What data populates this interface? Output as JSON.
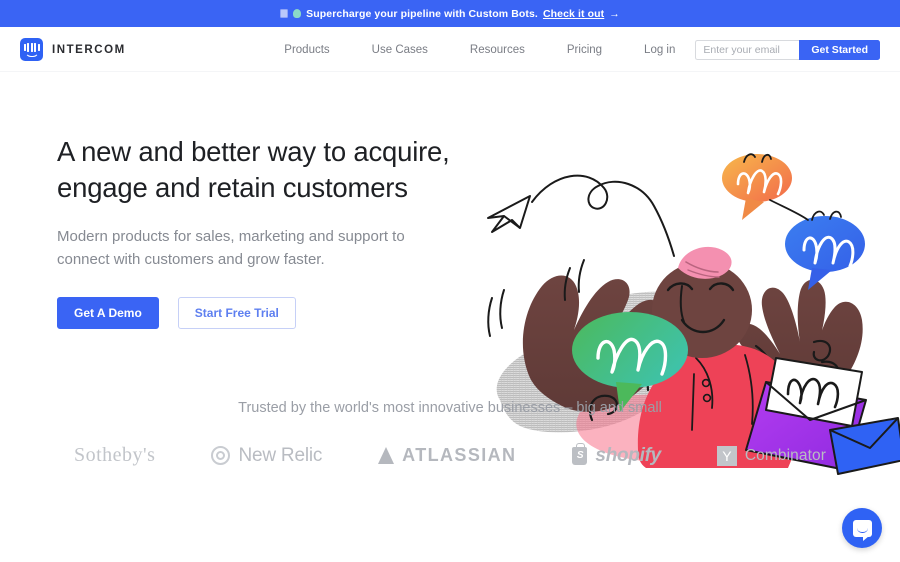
{
  "banner": {
    "icon_left": "robot-icon",
    "icon_right": "sparkle-icon",
    "text": "Supercharge your pipeline with Custom Bots.",
    "link_label": "Check it out",
    "arrow": "→",
    "background_color": "#3a64f4"
  },
  "header": {
    "logo_icon": "intercom-logo-icon",
    "brand_name": "INTERCOM",
    "nav_links": [
      {
        "label": "Products"
      },
      {
        "label": "Use Cases"
      },
      {
        "label": "Resources"
      },
      {
        "label": "Pricing"
      },
      {
        "label": "Log in"
      }
    ],
    "email_placeholder": "Enter your email",
    "email_value": "",
    "get_started_label": "Get Started",
    "accent_color": "#3a64f4"
  },
  "hero": {
    "title_line1": "A new and better way to acquire,",
    "title_line2": "engage and retain customers",
    "subtitle_line1": "Modern products for sales, marketing and support to",
    "subtitle_line2": "connect with customers and grow faster.",
    "primary_button": "Get A Demo",
    "secondary_button": "Start Free Trial",
    "illustration": "person-with-speech-bubbles-and-envelopes-illustration"
  },
  "trusted": {
    "heading": "Trusted by the world's most innovative businesses – big and small",
    "logos": [
      {
        "name": "Sotheby's",
        "icon": "none"
      },
      {
        "name": "New Relic",
        "icon": "concentric-circles-icon"
      },
      {
        "name": "ATLASSIAN",
        "icon": "triangle-icon"
      },
      {
        "name": "shopify",
        "icon": "shopping-bag-icon"
      },
      {
        "name": "Combinator",
        "icon": "y-square-icon",
        "mark": "Y"
      }
    ]
  },
  "messenger": {
    "icon": "chat-bubble-smile-icon",
    "color": "#2f62f4"
  }
}
